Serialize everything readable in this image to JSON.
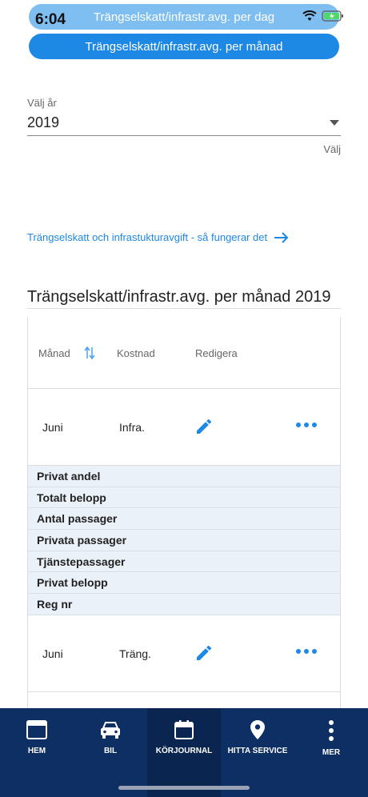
{
  "status_bar": {
    "time": "6:04"
  },
  "segments": {
    "per_day": "Trängselskatt/infrastr.avg. per dag",
    "per_month": "Trängselskatt/infrastr.avg. per månad"
  },
  "year_select": {
    "label": "Välj år",
    "value": "2019",
    "helper": "Välj"
  },
  "info_link": "Trängselskatt och infrastukturavgift - så fungerar det",
  "section_title": "Trängselskatt/infrastr.avg. per månad 2019",
  "table": {
    "headers": [
      "Månad",
      "Kostnad",
      "Redigera"
    ],
    "rows": [
      {
        "month": "Juni",
        "cost": "Infra."
      },
      {
        "month": "Juni",
        "cost": "Träng."
      }
    ],
    "details": [
      "Privat andel",
      "Totalt belopp",
      "Antal passager",
      "Privata passager",
      "Tjänstepassager",
      "Privat belopp",
      "Reg nr"
    ]
  },
  "nav": [
    {
      "label": "HEM",
      "icon": "home-icon"
    },
    {
      "label": "BIL",
      "icon": "car-icon"
    },
    {
      "label": "KÖRJOURNAL",
      "icon": "calendar-icon",
      "active": true
    },
    {
      "label": "HITTA SERVICE",
      "icon": "location-pin-icon"
    },
    {
      "label": "MER",
      "icon": "more-vertical-icon"
    }
  ],
  "colors": {
    "accent": "#1e88e5",
    "nav_bg": "#0d2f63",
    "detail_bg": "#eaf1f8"
  }
}
